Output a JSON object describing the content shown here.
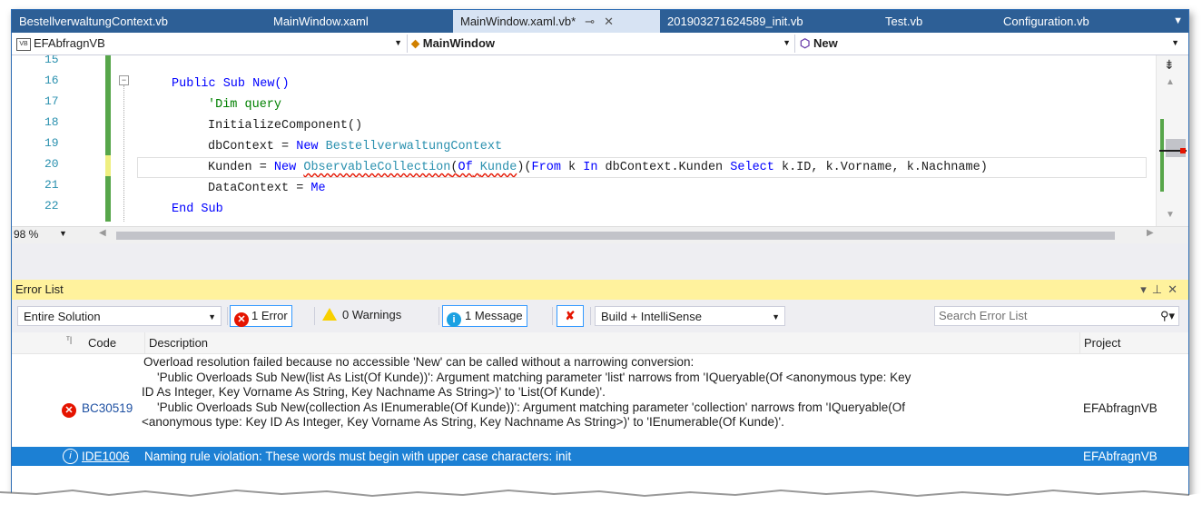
{
  "tabs": [
    {
      "label": "BestellverwaltungContext.vb",
      "active": false
    },
    {
      "label": "MainWindow.xaml",
      "active": false
    },
    {
      "label": "MainWindow.xaml.vb*",
      "active": true
    },
    {
      "label": "201903271624589_init.vb",
      "active": false
    },
    {
      "label": "Test.vb",
      "active": false
    },
    {
      "label": "Configuration.vb",
      "active": false
    }
  ],
  "navbar": {
    "project": "EFAbfragnVB",
    "type": "MainWindow",
    "member": "New"
  },
  "editor": {
    "zoom": "98 %",
    "line_numbers": [
      "15",
      "16",
      "17",
      "18",
      "19",
      "20",
      "21",
      "22"
    ],
    "lines": {
      "l16_kw": "Public Sub",
      "l16_rest": " New()",
      "l17": "'Dim query",
      "l18": "InitializeComponent()",
      "l19_a": "dbContext = ",
      "l19_kw": "New",
      "l19_ty": "BestellverwaltungContext",
      "l20_a": "Kunden = ",
      "l20_kw": "New",
      "l20_ty": "ObservableCollection",
      "l20_b": "(",
      "l20_kw2": "Of",
      "l20_ty2": "Kunde",
      "l20_c": ")(",
      "l20_kw3": "From",
      "l20_d": " k ",
      "l20_kw4": "In",
      "l20_e": " dbContext.Kunden ",
      "l20_kw5": "Select",
      "l20_f": " k.ID, k.Vorname, k.Nachname)",
      "l21_a": "DataContext = ",
      "l21_kw": "Me",
      "l22": "End Sub"
    }
  },
  "error_list": {
    "title": "Error List",
    "scope": "Entire Solution",
    "errors_label": "1 Error",
    "warnings_label": "0 Warnings",
    "messages_label": "1 Message",
    "source": "Build + IntelliSense",
    "search_placeholder": "Search Error List",
    "columns": {
      "code": "Code",
      "description": "Description",
      "project": "Project"
    },
    "rows": [
      {
        "code": "BC30519",
        "description_lines": [
          "Overload resolution failed because no accessible 'New' can be called without a narrowing conversion:",
          "    'Public Overloads Sub New(list As List(Of Kunde))': Argument matching parameter 'list' narrows from 'IQueryable(Of <anonymous type: Key",
          "ID As Integer, Key Vorname As String, Key Nachname As String>)' to 'List(Of Kunde)'.",
          "    'Public Overloads Sub New(collection As IEnumerable(Of Kunde))': Argument matching parameter 'collection' narrows from 'IQueryable(Of",
          "<anonymous type: Key ID As Integer, Key Vorname As String, Key Nachname As String>)' to 'IEnumerable(Of Kunde)'."
        ],
        "project": "EFAbfragnVB"
      },
      {
        "code": "IDE1006",
        "description": "Naming rule violation: These words must begin with upper case characters: init",
        "project": "EFAbfragnVB"
      }
    ]
  },
  "colors": {
    "accent": "#2d5f96",
    "selection": "#1c80d4",
    "panel_header": "#fff29d",
    "error": "#e51400",
    "info": "#1ba1e2"
  }
}
